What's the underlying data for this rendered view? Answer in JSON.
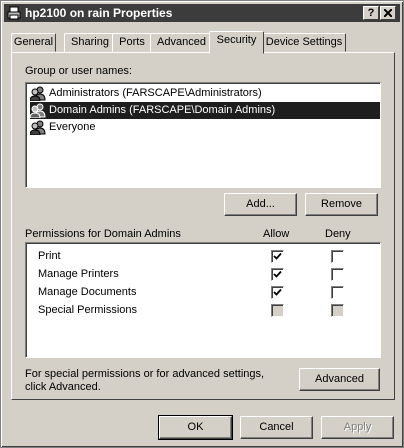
{
  "window": {
    "title": "hp2100 on rain Properties",
    "help_button": "?",
    "close_button": "X"
  },
  "tabs": [
    {
      "label": "General",
      "active": false
    },
    {
      "label": "Sharing",
      "active": false
    },
    {
      "label": "Ports",
      "active": false
    },
    {
      "label": "Advanced",
      "active": false
    },
    {
      "label": "Security",
      "active": true
    },
    {
      "label": "Device Settings",
      "active": false
    }
  ],
  "security": {
    "group_label": "Group or user names:",
    "users": [
      {
        "name": "Administrators (FARSCAPE\\Administrators)",
        "icon": "user-group-icon",
        "selected": false
      },
      {
        "name": "Domain Admins (FARSCAPE\\Domain Admins)",
        "icon": "user-group-icon",
        "selected": true
      },
      {
        "name": "Everyone",
        "icon": "user-group-icon",
        "selected": false
      }
    ],
    "add_button": "Add...",
    "remove_button": "Remove",
    "permissions_label": "Permissions for Domain Admins",
    "allow_header": "Allow",
    "deny_header": "Deny",
    "permissions": [
      {
        "name": "Print",
        "allow": "checked",
        "deny": "unchecked"
      },
      {
        "name": "Manage Printers",
        "allow": "checked",
        "deny": "unchecked"
      },
      {
        "name": "Manage Documents",
        "allow": "checked",
        "deny": "unchecked"
      },
      {
        "name": "Special Permissions",
        "allow": "grayed",
        "deny": "grayed"
      }
    ],
    "advanced_note_line1": "For special permissions or for advanced settings,",
    "advanced_note_line2": "click Advanced.",
    "advanced_button": "Advanced"
  },
  "footer": {
    "ok_button": "OK",
    "cancel_button": "Cancel",
    "apply_button": "Apply"
  },
  "colors": {
    "face": "#d4d0c8",
    "titlebar": "#3c3c3c",
    "selection": "#1e1e1e"
  }
}
